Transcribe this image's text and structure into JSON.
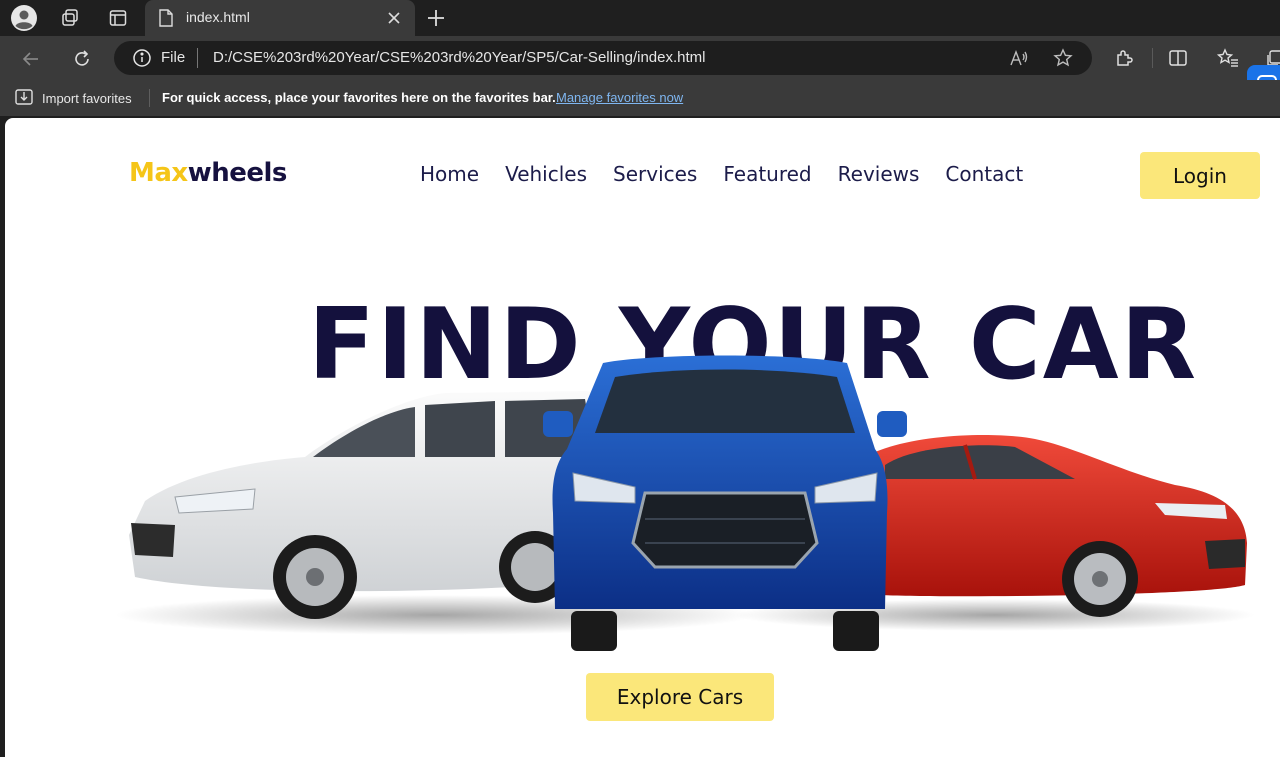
{
  "browser": {
    "tab_title": "index.html",
    "url_scheme": "File",
    "url": "D:/CSE%203rd%20Year/CSE%203rd%20Year/SP5/Car-Selling/index.html",
    "favorites": {
      "import_label": "Import favorites",
      "hint_text": "For quick access, place your favorites here on the favorites bar.",
      "manage_link": "Manage favorites now"
    }
  },
  "site": {
    "logo_max": "Max",
    "logo_wheels": "wheels",
    "nav": [
      "Home",
      "Vehicles",
      "Services",
      "Featured",
      "Reviews",
      "Contact"
    ],
    "login_label": "Login",
    "hero_title": "FIND YOUR CAR",
    "explore_label": "Explore Cars"
  },
  "colors": {
    "accent_yellow": "#fbe77a",
    "logo_yellow": "#f5c518",
    "navy": "#14113d"
  }
}
